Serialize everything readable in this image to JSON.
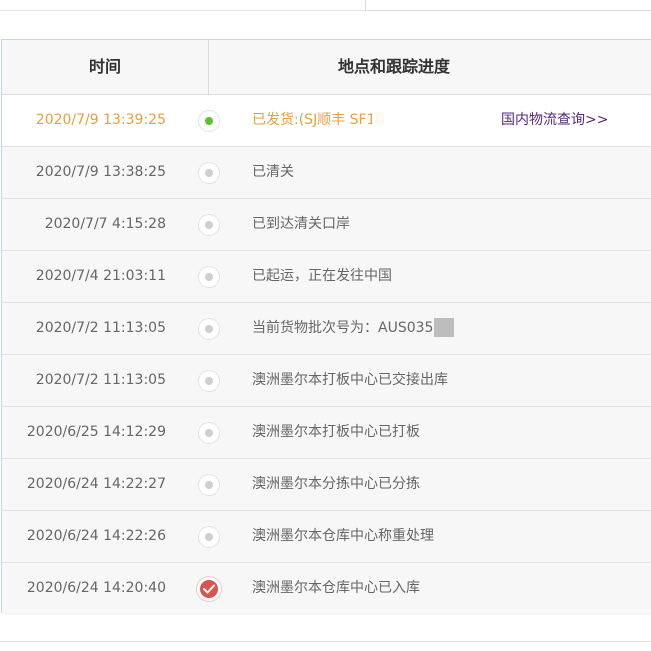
{
  "header": {
    "time_label": "时间",
    "location_label": "地点和跟踪进度"
  },
  "rows": [
    {
      "time": "2020/7/9 13:39:25",
      "status": "已发货:(SJ顺丰 SF10",
      "link": "国内物流查询>>",
      "state": "active"
    },
    {
      "time": "2020/7/9 13:38:25",
      "status": "已清关",
      "state": "normal"
    },
    {
      "time": "2020/7/7 4:15:28",
      "status": "已到达清关口岸",
      "state": "normal"
    },
    {
      "time": "2020/7/4 21:03:11",
      "status": "已起运，正在发往中国",
      "state": "normal"
    },
    {
      "time": "2020/7/2 11:13:05",
      "status": "当前货物批次号为：AUS035",
      "state": "normal"
    },
    {
      "time": "2020/7/2 11:13:05",
      "status": "澳洲墨尔本打板中心已交接出库",
      "state": "normal"
    },
    {
      "time": "2020/6/25 14:12:29",
      "status": "澳洲墨尔本打板中心已打板",
      "state": "normal"
    },
    {
      "time": "2020/6/24 14:22:27",
      "status": "澳洲墨尔本分拣中心已分拣",
      "state": "normal"
    },
    {
      "time": "2020/6/24 14:22:26",
      "status": "澳洲墨尔本仓库中心称重处理",
      "state": "normal"
    },
    {
      "time": "2020/6/24 14:20:40",
      "status": "澳洲墨尔本仓库中心已入库",
      "state": "done"
    }
  ],
  "colors": {
    "active_text": "#e9a03b",
    "active_dot": "#5fc02d",
    "done_dot": "#d9534f",
    "link": "#552a80",
    "table_border": "#bcd8ea"
  }
}
